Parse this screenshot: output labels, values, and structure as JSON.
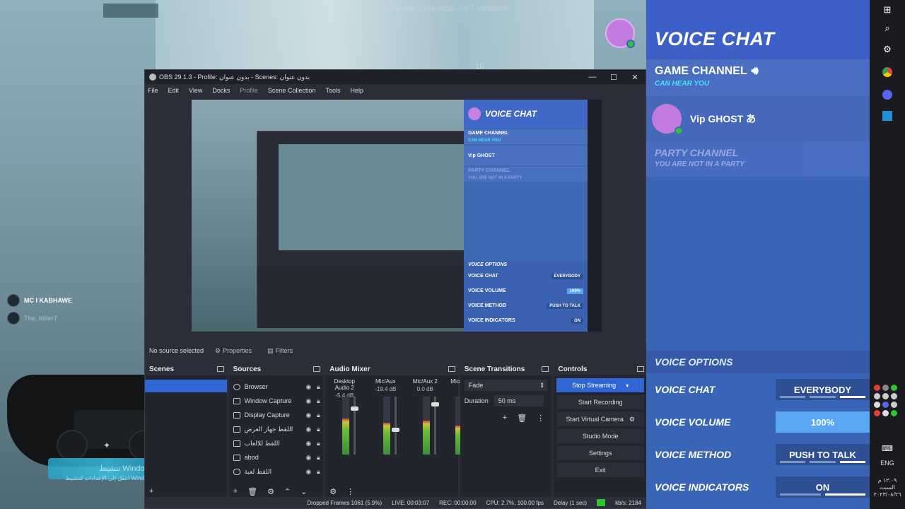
{
  "background": {
    "hud_text": "Preview 2334-5526-2967 version #",
    "hud_small": "10",
    "players": [
      {
        "name": "MC I KABHAWE"
      },
      {
        "name": "The_killer7"
      }
    ],
    "watermark_line1": "تنشيط Windows",
    "watermark_line2": "انتقل إلى الإعدادات لتنشيط Windows"
  },
  "obs": {
    "title": "OBS 29.1.3 - Profile: بدون عنوان - Scenes: بدون عنوان",
    "menu": [
      "File",
      "Edit",
      "View",
      "Docks",
      "Profile",
      "Scene Collection",
      "Tools",
      "Help"
    ],
    "preview": {
      "vc_title": "VOICE CHAT",
      "game_channel": "GAME CHANNEL",
      "can_hear": "CAN HEAR YOU",
      "member": "Vip GHOST",
      "party_channel": "PARTY CHANNEL",
      "party_sub": "YOU ARE NOT IN A PARTY",
      "options_head": "VOICE OPTIONS",
      "options": [
        {
          "label": "VOICE CHAT",
          "value": "EVERYBODY"
        },
        {
          "label": "VOICE VOLUME",
          "value": "100%"
        },
        {
          "label": "VOICE METHOD",
          "value": "PUSH TO TALK"
        },
        {
          "label": "VOICE INDICATORS",
          "value": "ON"
        }
      ]
    },
    "source_bar": {
      "none_selected": "No source selected",
      "properties": "Properties",
      "filters": "Filters"
    },
    "docks": {
      "scenes_title": "Scenes",
      "sources_title": "Sources",
      "mixer_title": "Audio Mixer",
      "transitions_title": "Scene Transitions",
      "controls_title": "Controls"
    },
    "sources": [
      {
        "label": "Browser",
        "icon": "browser-icon"
      },
      {
        "label": "Window Capture",
        "icon": "window-icon"
      },
      {
        "label": "Display Capture",
        "icon": "display-icon"
      },
      {
        "label": "اللقط جهاز العرض",
        "icon": "capture-icon"
      },
      {
        "label": "اللقط للالعاب",
        "icon": "game-icon"
      },
      {
        "label": "abod",
        "icon": "image-icon"
      },
      {
        "label": "اللقط لعبة",
        "icon": "gamepad-icon"
      }
    ],
    "mixer": [
      {
        "name": "Desktop Audio 2",
        "db": "-5.4 dB",
        "level": 0.62,
        "fader": 0.82
      },
      {
        "name": "Mic/Aux",
        "db": "-19.4 dB",
        "level": 0.55,
        "fader": 0.42
      },
      {
        "name": "Mic/Aux 2",
        "db": "0.0 dB",
        "level": 0.58,
        "fader": 0.9
      },
      {
        "name": "Mic/A",
        "db": "",
        "level": 0.5,
        "fader": 0.9
      }
    ],
    "transitions": {
      "selected": "Fade",
      "duration_label": "Duration",
      "duration_value": "50 ms"
    },
    "controls": [
      "Stop Streaming",
      "Start Recording",
      "Start Virtual Camera",
      "Studio Mode",
      "Settings",
      "Exit"
    ],
    "status": {
      "dropped": "Dropped Frames 1061 (5.9%)",
      "live": "LIVE: 00:03:07",
      "rec": "REC: 00:00:00",
      "cpu": "CPU: 2.7%, 100.00 fps",
      "delay": "Delay (1 sec)",
      "kbs": "kb/s: 2184"
    }
  },
  "voice_chat": {
    "title": "VOICE CHAT",
    "game_channel": "GAME CHANNEL",
    "can_hear": "CAN HEAR YOU",
    "member": "Vip GHOST あ",
    "party_channel": "PARTY CHANNEL",
    "party_sub": "YOU ARE NOT IN A PARTY",
    "options_head": "VOICE OPTIONS",
    "options": [
      {
        "label": "VOICE CHAT",
        "value": "EVERYBODY",
        "highlight": false
      },
      {
        "label": "VOICE VOLUME",
        "value": "100%",
        "highlight": true
      },
      {
        "label": "VOICE METHOD",
        "value": "PUSH TO TALK",
        "highlight": false
      },
      {
        "label": "VOICE INDICATORS",
        "value": "ON",
        "highlight": false
      }
    ],
    "colors": {
      "panel": "#3a64b5",
      "highlight": "#5aa8f5",
      "can_hear": "#40e5f5",
      "online": "#2ec52e"
    }
  },
  "taskbar": {
    "icons": [
      "windows-icon",
      "search-icon",
      "gear-icon",
      "chrome-icon",
      "discord-icon",
      "store-icon"
    ],
    "lang": "ENG",
    "clock_time": "١٢:٠٩ م",
    "clock_day": "السبت",
    "clock_date": "٢٠٢٣/٠٨/٢٦"
  }
}
